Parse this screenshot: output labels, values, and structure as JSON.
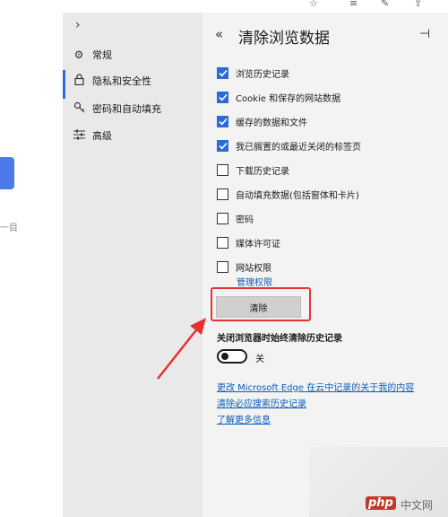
{
  "colors": {
    "accent": "#2b6ad9",
    "highlight": "#e8322f",
    "nav_bg": "#e9e9e9",
    "panel_bg": "#f3f3f3"
  },
  "page": {
    "side_text": "一目"
  },
  "nav": {
    "expand_icon": "chevron-right-icon",
    "items": [
      {
        "icon": "gear-icon",
        "label": "常规"
      },
      {
        "icon": "lock-icon",
        "label": "隐私和安全性"
      },
      {
        "icon": "key-icon",
        "label": "密码和自动填充"
      },
      {
        "icon": "sliders-icon",
        "label": "高级"
      }
    ],
    "active_index": 1
  },
  "panel": {
    "title": "清除浏览数据",
    "back_icon": "double-chevron-left-icon",
    "pin_icon": "pin-icon",
    "checkboxes": [
      {
        "label": "浏览历史记录",
        "checked": true
      },
      {
        "label": "Cookie 和保存的网站数据",
        "checked": true
      },
      {
        "label": "缓存的数据和文件",
        "checked": true
      },
      {
        "label": "我已搁置的或最近关闭的标签页",
        "checked": true
      },
      {
        "label": "下载历史记录",
        "checked": false
      },
      {
        "label": "自动填充数据(包括窗体和卡片)",
        "checked": false
      },
      {
        "label": "密码",
        "checked": false
      },
      {
        "label": "媒体许可证",
        "checked": false
      },
      {
        "label": "网站权限",
        "checked": false
      }
    ],
    "manage_link": "管理权限",
    "clear_button": "清除",
    "always_clear_heading": "关闭浏览器时始终清除历史记录",
    "toggle": {
      "state": "off",
      "label": "关"
    },
    "links": [
      "更改 Microsoft Edge 在云中记录的关于我的内容",
      "清除必应搜索历史记录",
      "了解更多信息"
    ]
  },
  "watermark": {
    "brand": "php",
    "site": "中文网"
  }
}
